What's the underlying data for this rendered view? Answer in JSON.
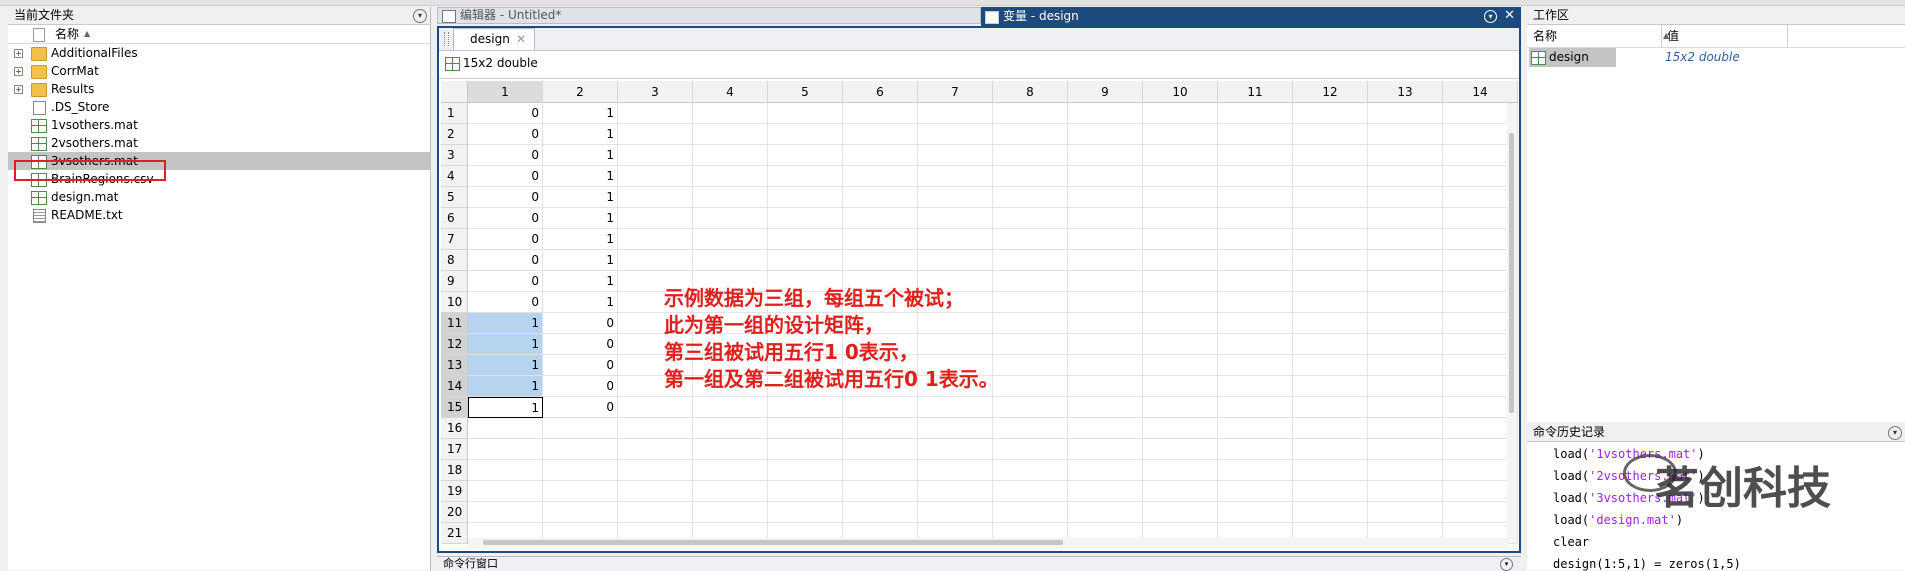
{
  "file_browser": {
    "title": "当前文件夹",
    "column_name": "名称",
    "sort_arrow": "▲",
    "items": [
      {
        "name": "AdditionalFiles",
        "type": "folder",
        "expandable": true
      },
      {
        "name": "CorrMat",
        "type": "folder",
        "expandable": true
      },
      {
        "name": "Results",
        "type": "folder",
        "expandable": true
      },
      {
        "name": ".DS_Store",
        "type": "file"
      },
      {
        "name": "1vsothers.mat",
        "type": "mat"
      },
      {
        "name": "2vsothers.mat",
        "type": "mat"
      },
      {
        "name": "3vsothers.mat",
        "type": "mat",
        "selected": true
      },
      {
        "name": "BrainRegions.csv",
        "type": "mat"
      },
      {
        "name": "design.mat",
        "type": "mat"
      },
      {
        "name": "README.txt",
        "type": "txt"
      }
    ]
  },
  "editor": {
    "tab_label": "编辑器 - Untitled*"
  },
  "variables": {
    "title": "变量 - design",
    "tab_label": "design",
    "size_label": "15x2 double",
    "columns": [
      "1",
      "2",
      "3",
      "4",
      "5",
      "6",
      "7",
      "8",
      "9",
      "10",
      "11",
      "12",
      "13",
      "14"
    ],
    "rows": [
      "1",
      "2",
      "3",
      "4",
      "5",
      "6",
      "7",
      "8",
      "9",
      "10",
      "11",
      "12",
      "13",
      "14",
      "15",
      "16",
      "17",
      "18",
      "19",
      "20",
      "21"
    ],
    "data": [
      [
        "0",
        "1"
      ],
      [
        "0",
        "1"
      ],
      [
        "0",
        "1"
      ],
      [
        "0",
        "1"
      ],
      [
        "0",
        "1"
      ],
      [
        "0",
        "1"
      ],
      [
        "0",
        "1"
      ],
      [
        "0",
        "1"
      ],
      [
        "0",
        "1"
      ],
      [
        "0",
        "1"
      ],
      [
        "1",
        "0"
      ],
      [
        "1",
        "0"
      ],
      [
        "1",
        "0"
      ],
      [
        "1",
        "0"
      ],
      [
        "1",
        "0"
      ]
    ],
    "annotation": [
      "示例数据为三组，每组五个被试；",
      "此为第一组的设计矩阵，",
      "第三组被试用五行1 0表示，",
      "第一组及第二组被试用五行0 1表示。"
    ]
  },
  "workspace": {
    "title": "工作区",
    "col_name": "名称",
    "col_value": "值",
    "var_name": "design",
    "var_value": "15x2 double"
  },
  "history": {
    "title": "命令历史记录",
    "lines": [
      {
        "cmd": "load(",
        "str": "'1vsothers.mat'",
        "end": ")"
      },
      {
        "cmd": "load(",
        "str": "'2vsothers.mat'",
        "end": ")"
      },
      {
        "cmd": "load(",
        "str": "'3vsothers.mat'",
        "end": ")"
      },
      {
        "cmd": "load(",
        "str": "'design.mat'",
        "end": ")"
      },
      {
        "cmd": "clear",
        "str": "",
        "end": ""
      },
      {
        "cmd": "design(1:5,1) = zeros(1,5)",
        "str": "",
        "end": ""
      }
    ],
    "watermark": "茗创科技"
  },
  "command_window": {
    "title": "命令行窗口"
  }
}
